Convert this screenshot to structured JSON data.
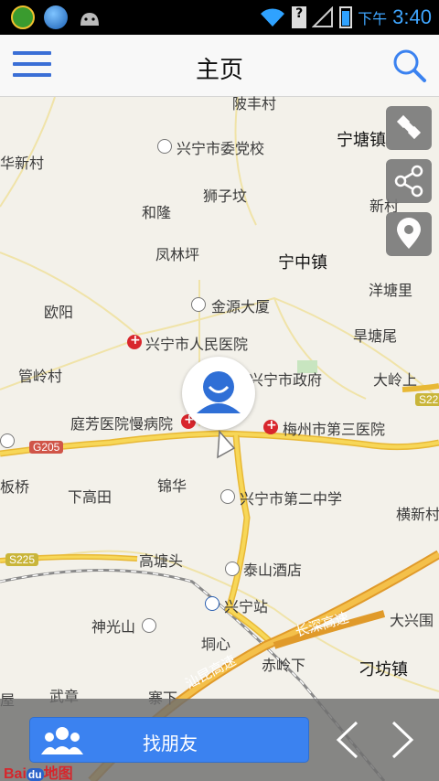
{
  "status_bar": {
    "ampm": "下午",
    "time": "3:40"
  },
  "app_bar": {
    "title": "主页"
  },
  "map_labels": [
    {
      "text": "陂丰村"
    },
    {
      "text": "兴宁市委党校"
    },
    {
      "text": "宁塘镇"
    },
    {
      "text": "华新村"
    },
    {
      "text": "狮子坟"
    },
    {
      "text": "新村"
    },
    {
      "text": "和隆"
    },
    {
      "text": "凤林坪"
    },
    {
      "text": "宁中镇"
    },
    {
      "text": "洋塘里"
    },
    {
      "text": "欧阳"
    },
    {
      "text": "金源大厦"
    },
    {
      "text": "旱塘尾"
    },
    {
      "text": "兴宁市人民医院"
    },
    {
      "text": "管岭村"
    },
    {
      "text": "兴宁市政府"
    },
    {
      "text": "大岭上"
    },
    {
      "text": "庭芳医院慢病院"
    },
    {
      "text": "梅州市第三医院"
    },
    {
      "text": "板桥"
    },
    {
      "text": "下高田"
    },
    {
      "text": "锦华"
    },
    {
      "text": "兴宁市第二中学"
    },
    {
      "text": "横新村"
    },
    {
      "text": "高塘头"
    },
    {
      "text": "泰山酒店"
    },
    {
      "text": "兴宁站"
    },
    {
      "text": "神光山"
    },
    {
      "text": "大兴围"
    },
    {
      "text": "长深高速"
    },
    {
      "text": "垌心"
    },
    {
      "text": "赤岭下"
    },
    {
      "text": "刁坊镇"
    },
    {
      "text": "汕昆高速"
    },
    {
      "text": "屋"
    },
    {
      "text": "武章"
    },
    {
      "text": "寨下"
    }
  ],
  "road_shields": {
    "g205": "G205",
    "s225_left": "S225",
    "s225_right": "S22"
  },
  "bottom_bar": {
    "find_friends": "找朋友"
  },
  "logo": {
    "text_a": "Bai",
    "text_b": "du",
    "text_c": "地图"
  },
  "colors": {
    "accent": "#3b82f0",
    "road": "#f5d24a",
    "map_bg": "#f3f1ea"
  },
  "icons": {
    "menu": "hamburger-icon",
    "search": "search-icon",
    "satellite": "satellite-icon",
    "share": "share-icon",
    "location": "location-pin-icon",
    "friends": "friends-icon"
  }
}
